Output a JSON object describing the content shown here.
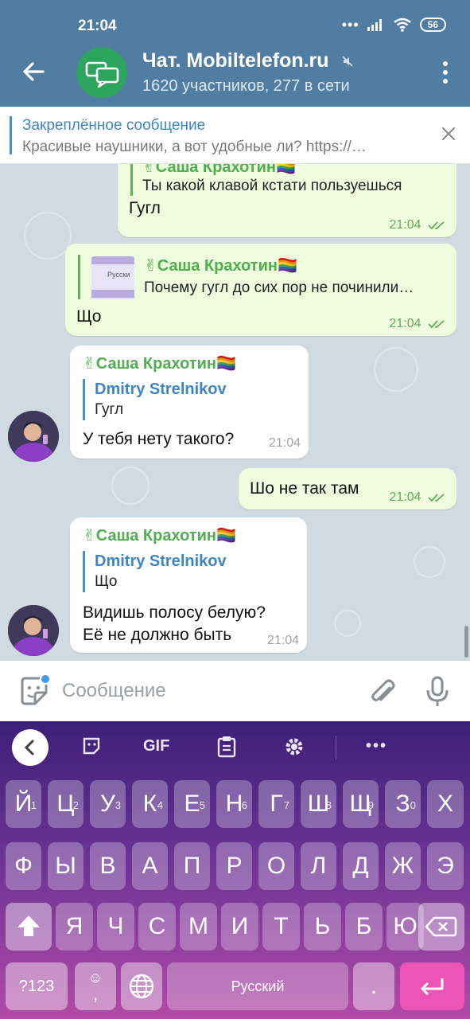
{
  "status_bar": {
    "time": "21:04",
    "dots": "•••",
    "battery": "56"
  },
  "header": {
    "title": "Чат. Mobiltelefon.ru",
    "subtitle": "1620 участников, 277 в сети"
  },
  "pinned": {
    "title": "Закреплённое сообщение",
    "text": "Красивые наушники, а вот удобные ли? https://…"
  },
  "messages": [
    {
      "reply_name": "✌Саша Крахотин🏳️‍🌈",
      "reply_text": "Ты какой клавой кстати пользуешься",
      "text": "Гугл",
      "time": "21:04"
    },
    {
      "reply_name": "✌Саша Крахотин🏳️‍🌈",
      "reply_text": "Почему гугл до сих пор не починили…",
      "thumb_text": "Русски",
      "text": "Що",
      "time": "21:04"
    },
    {
      "sender": "✌Саша Крахотин🏳️‍🌈",
      "reply_name": "Dmitry Strelnikov",
      "reply_text": "Гугл",
      "text": "У тебя нету такого?",
      "time": "21:04"
    },
    {
      "text": "Шо не так там",
      "time": "21:04"
    },
    {
      "sender": "✌Саша Крахотин🏳️‍🌈",
      "reply_name": "Dmitry Strelnikov",
      "reply_text": "Що",
      "text_line1": "Видишь полосу белую?",
      "text_line2": "Её не должно быть",
      "time": "21:04"
    }
  ],
  "input": {
    "placeholder": "Сообщение"
  },
  "keyboard": {
    "toolbar": {
      "gif": "GIF",
      "more": "•••"
    },
    "row1": [
      {
        "k": "Й",
        "s": "1"
      },
      {
        "k": "Ц",
        "s": "2"
      },
      {
        "k": "У",
        "s": "3"
      },
      {
        "k": "К",
        "s": "4"
      },
      {
        "k": "Е",
        "s": "5"
      },
      {
        "k": "Н",
        "s": "6"
      },
      {
        "k": "Г",
        "s": "7"
      },
      {
        "k": "Ш",
        "s": "8"
      },
      {
        "k": "Щ",
        "s": "9"
      },
      {
        "k": "З",
        "s": "0"
      },
      {
        "k": "Х",
        "s": ""
      }
    ],
    "row2": [
      "Ф",
      "Ы",
      "В",
      "А",
      "П",
      "Р",
      "О",
      "Л",
      "Д",
      "Ж",
      "Э"
    ],
    "row3": [
      "Я",
      "Ч",
      "С",
      "М",
      "И",
      "Т",
      "Ь",
      "Б",
      "Ю"
    ],
    "symbols": "?123",
    "emoji_key_emoji": "☺",
    "emoji_key_comma": ",",
    "space": "Русский",
    "period": "."
  },
  "colors": {
    "header": "#517da2",
    "outgoing_bubble": "#effdde",
    "name_green": "#4fae4e",
    "name_blue": "#3d85c6",
    "enter": "#ec54b6"
  },
  "icons": [
    "back-arrow-icon",
    "group-chat-icon",
    "mute-icon",
    "more-vert-icon",
    "close-icon",
    "double-check-icon",
    "sticker-icon",
    "attach-icon",
    "mic-icon",
    "chevron-left-icon",
    "gif-sticker-icon",
    "clipboard-icon",
    "gear-icon",
    "shift-icon",
    "backspace-icon",
    "globe-icon",
    "enter-icon"
  ]
}
